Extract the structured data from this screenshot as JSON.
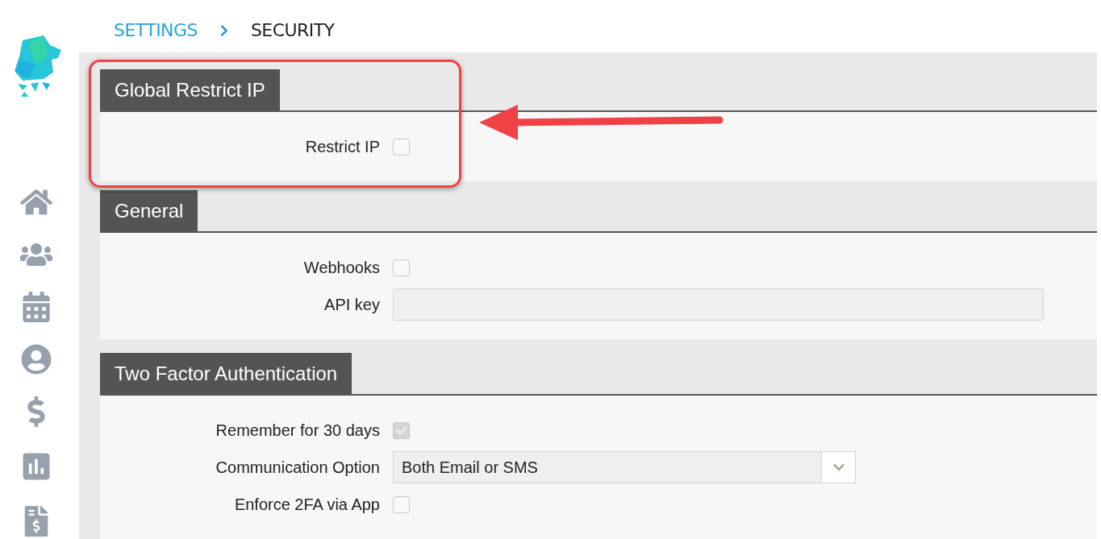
{
  "breadcrumb": [
    {
      "label": "SETTINGS",
      "selected": false
    },
    {
      "label": "SECURITY",
      "selected": true
    }
  ],
  "sections": [
    {
      "title": "Global Restrict IP",
      "highlighted": true,
      "fields": [
        {
          "kind": "checkbox",
          "label": "Restrict IP",
          "checked": false,
          "disabled": false
        }
      ]
    },
    {
      "title": "General",
      "highlighted": false,
      "fields": [
        {
          "kind": "checkbox",
          "label": "Webhooks",
          "checked": false,
          "disabled": false
        },
        {
          "kind": "text",
          "label": "API key"
        }
      ]
    },
    {
      "title": "Two Factor Authentication",
      "highlighted": false,
      "fields": [
        {
          "kind": "checkbox",
          "label": "Remember for 30 days",
          "checked": true,
          "disabled": true
        },
        {
          "kind": "select",
          "label": "Communication Option",
          "value": "Both Email or SMS"
        },
        {
          "kind": "checkbox",
          "label": "Enforce 2FA via App",
          "checked": false,
          "disabled": false
        }
      ]
    }
  ]
}
